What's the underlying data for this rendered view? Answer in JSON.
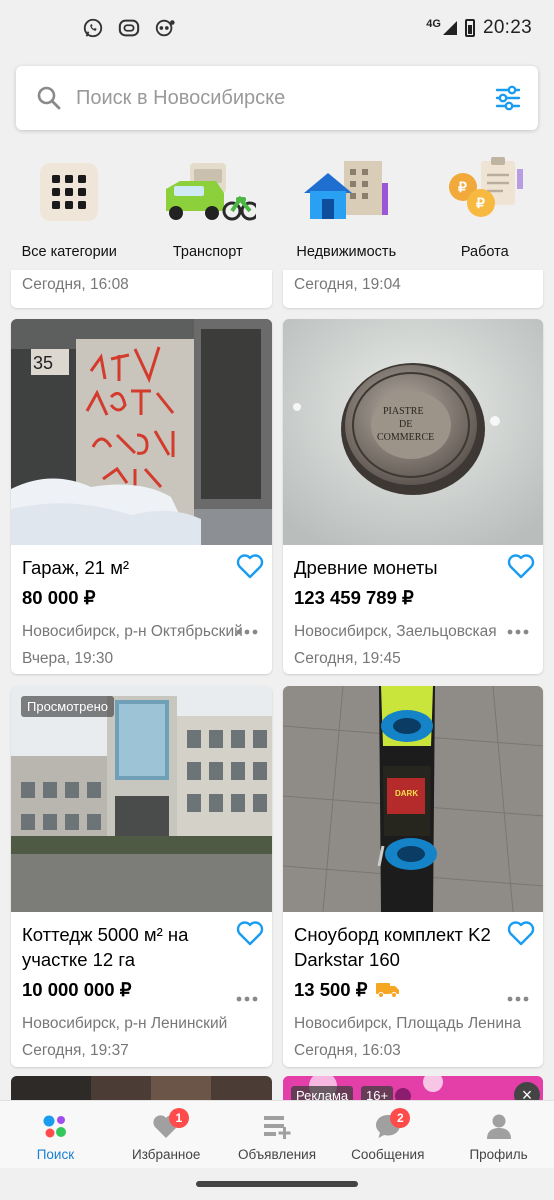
{
  "status_bar": {
    "network": "4G",
    "time": "20:23",
    "icons": [
      "whatsapp-icon",
      "messenger-icon",
      "voicemail-icon"
    ]
  },
  "search": {
    "placeholder": "Поиск в Новосибирске"
  },
  "categories": [
    {
      "label": "Все категории",
      "icon": "grid-icon"
    },
    {
      "label": "Транспорт",
      "icon": "transport-icon"
    },
    {
      "label": "Недвижимость",
      "icon": "real-estate-icon"
    },
    {
      "label": "Работа",
      "icon": "job-icon"
    }
  ],
  "partial_cards": [
    {
      "date": "Сегодня, 16:08"
    },
    {
      "date": "Сегодня, 19:04"
    }
  ],
  "listings": [
    {
      "title": "Гараж, 21 м²",
      "price": "80 000 ₽",
      "location": "Новосибирск, р-н Октябрьский",
      "date": "Вчера, 19:30"
    },
    {
      "title": "Древние монеты",
      "price": "123 459 789 ₽",
      "location": "Новосибирск, Заельцовская",
      "date": "Сегодня, 19:45"
    },
    {
      "title": "Коттедж 5000 м² на участке 12 га",
      "price": "10 000 000 ₽",
      "location": "Новосибирск, р-н Ленинский",
      "date": "Сегодня, 19:37",
      "badge": "Просмотрено"
    },
    {
      "title": "Сноуборд комплект K2 Darkstar 160",
      "price": "13 500 ₽",
      "location": "Новосибирск, Площадь Ленина",
      "date": "Сегодня, 16:03",
      "delivery_icon": "truck-icon"
    }
  ],
  "ad_strip": {
    "ad_label": "Реклама",
    "age_label": "16+"
  },
  "tabs": [
    {
      "label": "Поиск",
      "icon": "search-tab-icon",
      "active": true
    },
    {
      "label": "Избранное",
      "icon": "heart-icon",
      "badge": "1"
    },
    {
      "label": "Объявления",
      "icon": "listings-add-icon"
    },
    {
      "label": "Сообщения",
      "icon": "chat-icon",
      "badge": "2"
    },
    {
      "label": "Профиль",
      "icon": "profile-icon"
    }
  ],
  "colors": {
    "accent": "#1a9cf0",
    "active_tab": "#1a7fd4",
    "badge": "#ff4b4b",
    "delivery": "#f5a623"
  }
}
